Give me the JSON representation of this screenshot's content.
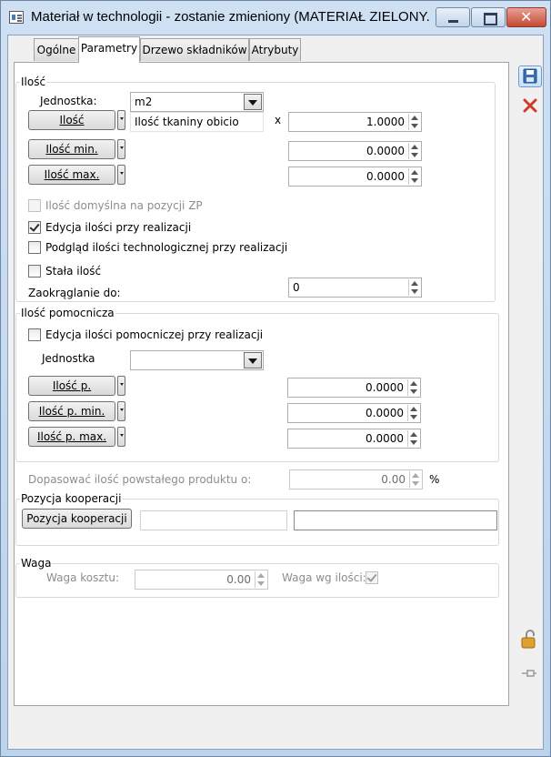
{
  "window": {
    "title": "Materiał w technologii - zostanie zmieniony  (MATERIAŁ ZIELONY..."
  },
  "tabs": [
    {
      "label": "Ogólne"
    },
    {
      "label": "Parametry"
    },
    {
      "label": "Drzewo składników"
    },
    {
      "label": "Atrybuty"
    }
  ],
  "ilosc": {
    "group_label": "Ilość",
    "jednostka_label": "Jednostka:",
    "jednostka_value": "m2",
    "ilosc_button": "Ilość",
    "ilosc_desc": "Ilość tkaniny obicio",
    "multiply": "x",
    "ilosc_value": "1.0000",
    "ilosc_min_button": "Ilość min.",
    "ilosc_min_value": "0.0000",
    "ilosc_max_button": "Ilość max.",
    "ilosc_max_value": "0.0000",
    "domyslna_label": "Ilość domyślna na pozycji ZP",
    "edycja_label": "Edycja ilości przy realizacji",
    "podglad_label": "Podgląd ilości technologicznej przy realizacji",
    "stala_label": "Stała ilość",
    "zaokraglanie_label": "Zaokrąglanie do:",
    "zaokraglanie_value": "0"
  },
  "pomocnicza": {
    "group_label": "Ilość pomocnicza",
    "edycja_label": "Edycja ilości pomocniczej przy realizacji",
    "jednostka_label": "Jednostka",
    "jednostka_value": "",
    "ilosc_p_button": "Ilość p.",
    "ilosc_p_value": "0.0000",
    "ilosc_p_min_button": "Ilość p. min.",
    "ilosc_p_min_value": "0.0000",
    "ilosc_p_max_button": "Ilość p. max.",
    "ilosc_p_max_value": "0.0000"
  },
  "dopasowac": {
    "label": "Dopasować ilość powstałego produktu o:",
    "value": "0.00",
    "unit": "%"
  },
  "kooperacja": {
    "group_label": "Pozycja kooperacji",
    "button": "Pozycja kooperacji",
    "field1": "",
    "field2": ""
  },
  "waga": {
    "group_label": "Waga",
    "koszt_label": "Waga kosztu:",
    "koszt_value": "0.00",
    "wg_ilosci_label": "Waga wg ilości:"
  },
  "checks": {
    "domyslna": false,
    "edycja": true,
    "podglad": false,
    "stala": false,
    "pomocnicza_edycja": false,
    "waga_wg_ilosci": true
  },
  "icons": [
    "app-icon",
    "save-icon",
    "cancel-icon",
    "lock-icon",
    "pin-icon"
  ],
  "colors": {
    "cancel": "#d03a2a",
    "save": "#3b6fb6",
    "titlebar": "#c4d8ee"
  }
}
